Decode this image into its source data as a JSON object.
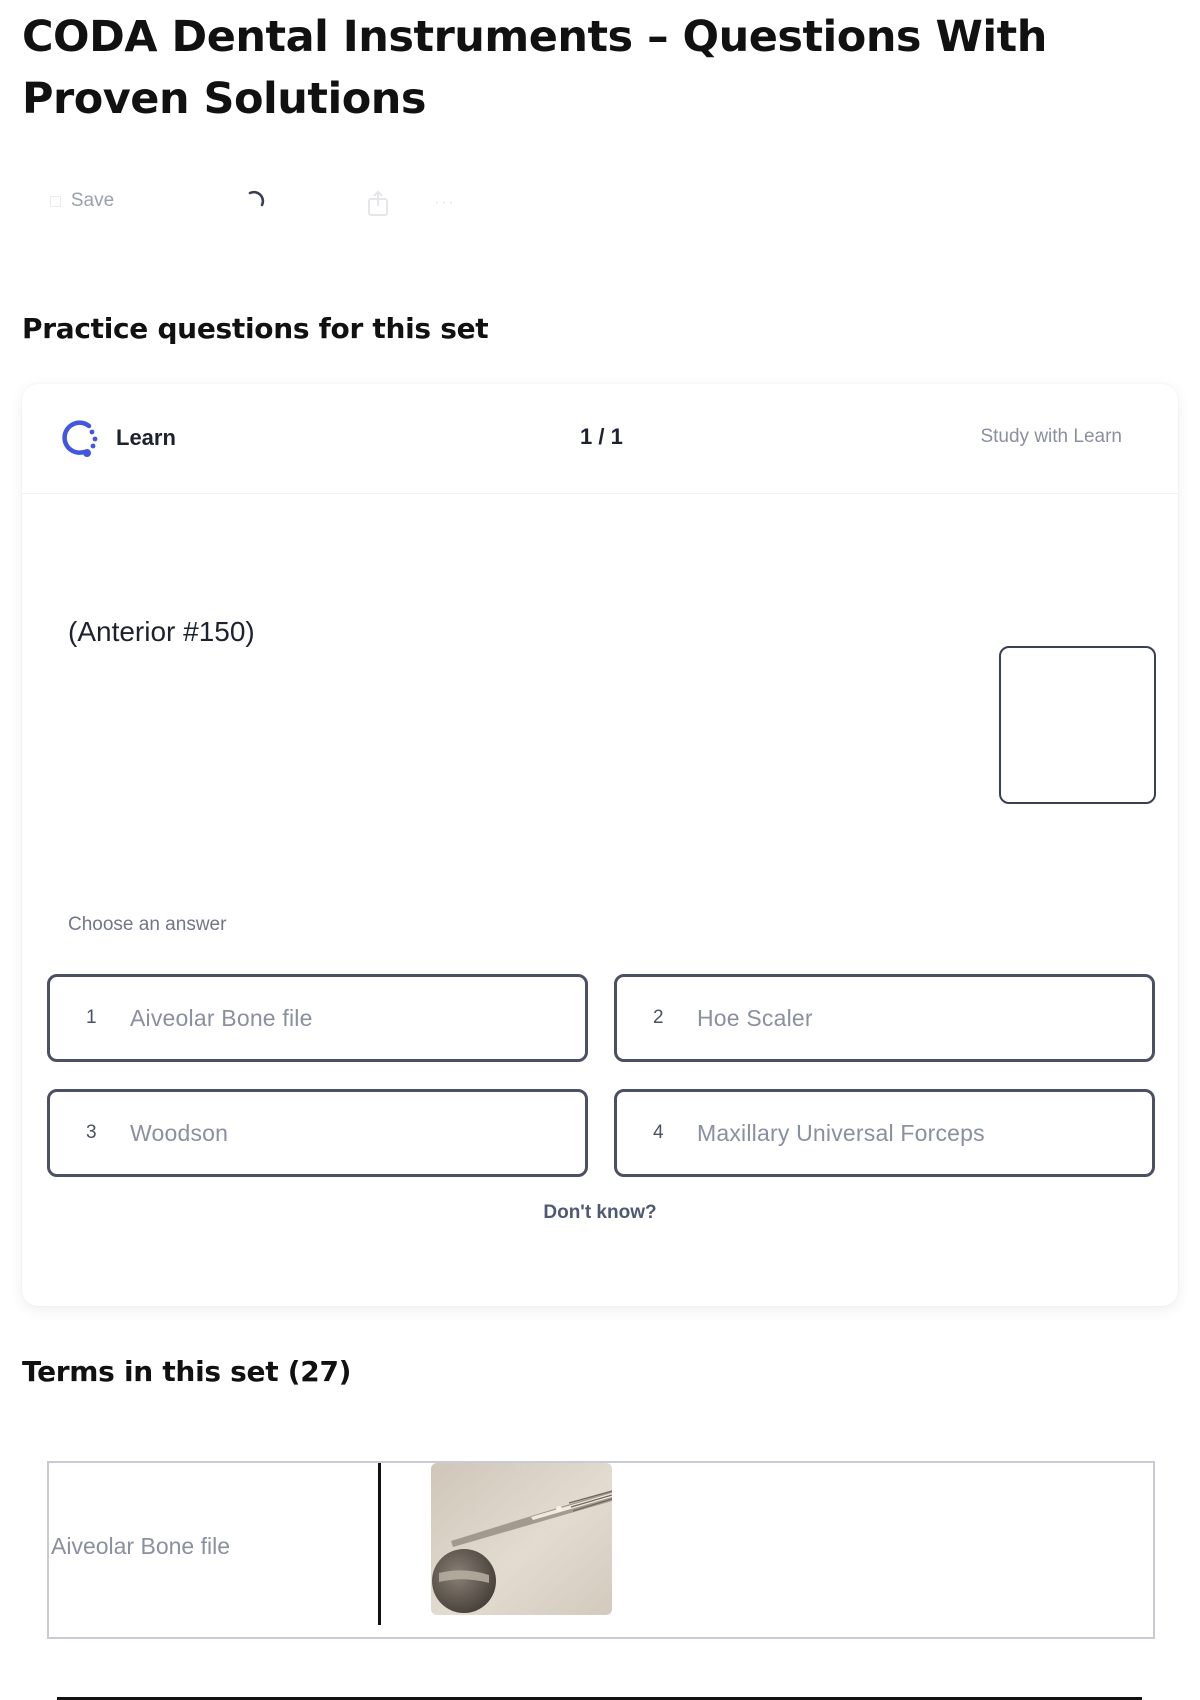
{
  "page": {
    "title": "CODA Dental Instruments – Questions With Proven Solutions"
  },
  "actions": {
    "save_label": "Save",
    "more_label": "···"
  },
  "practice": {
    "heading": "Practice questions for this set",
    "mode_label": "Learn",
    "counter": "1 / 1",
    "study_link": "Study with Learn",
    "prompt": "(Anterior #150)",
    "choose_label": "Choose an answer",
    "options": [
      {
        "number": "1",
        "text": "Aiveolar Bone file"
      },
      {
        "number": "2",
        "text": "Hoe Scaler"
      },
      {
        "number": "3",
        "text": "Woodson"
      },
      {
        "number": "4",
        "text": "Maxillary Universal Forceps"
      }
    ],
    "dont_know": "Don't know?"
  },
  "terms": {
    "heading": "Terms in this set (27)",
    "items": [
      {
        "term": "Aiveolar Bone file",
        "image_icon": "instrument-photo"
      }
    ]
  },
  "colors": {
    "accent": "#4257e0",
    "text_primary": "#111111",
    "text_muted": "#8a90a0",
    "option_border": "#4b5063"
  }
}
